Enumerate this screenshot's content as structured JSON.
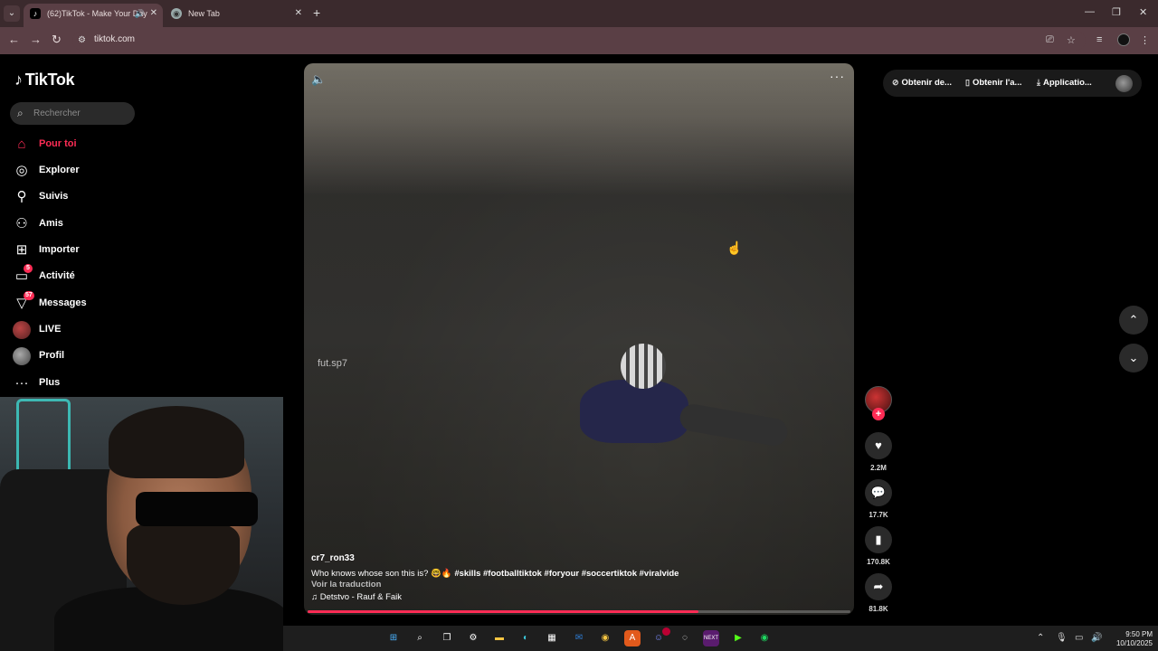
{
  "browser": {
    "tabs": [
      {
        "title": "(62)TikTok - Make Your Day",
        "active": true
      },
      {
        "title": "New Tab",
        "active": false
      }
    ],
    "url": "tiktok.com"
  },
  "sidebar": {
    "logo_text": "TikTok",
    "search_placeholder": "Rechercher",
    "items": [
      {
        "label": "Pour toi",
        "icon": "home-icon",
        "active": true
      },
      {
        "label": "Explorer",
        "icon": "compass-icon"
      },
      {
        "label": "Suivis",
        "icon": "following-icon"
      },
      {
        "label": "Amis",
        "icon": "friends-icon"
      },
      {
        "label": "Importer",
        "icon": "upload-icon"
      },
      {
        "label": "Activité",
        "icon": "activity-icon",
        "badge": "5"
      },
      {
        "label": "Messages",
        "icon": "messages-icon",
        "badge": "57"
      },
      {
        "label": "LIVE",
        "icon": "live-avatar"
      },
      {
        "label": "Profil",
        "icon": "profile-avatar"
      },
      {
        "label": "Plus",
        "icon": "more-icon"
      }
    ]
  },
  "video": {
    "watermark": "fut.sp7",
    "author": "cr7_ron33",
    "caption_text": "Who knows whose son this is? 🤓🔥",
    "hashtags": "#skills  #footballtiktok  #foryour  #soccertiktok  #viralvide",
    "translate_label": "Voir la traduction",
    "music": "Detstvo - Rauf & Faik",
    "progress": 0.72
  },
  "actions": {
    "likes": "2.2M",
    "comments": "17.7K",
    "saves": "170.8K",
    "shares": "81.8K"
  },
  "top_right": {
    "pill1": "Obtenir de...",
    "pill2": "Obtenir l'a...",
    "pill3": "Applicatio..."
  },
  "taskbar": {
    "time": "9:50 PM",
    "date": "10/10/2025"
  },
  "colors": {
    "accent": "#fe2c55",
    "chrome_tab": "#3b2a2d",
    "chrome_bar": "#5a3f45"
  }
}
